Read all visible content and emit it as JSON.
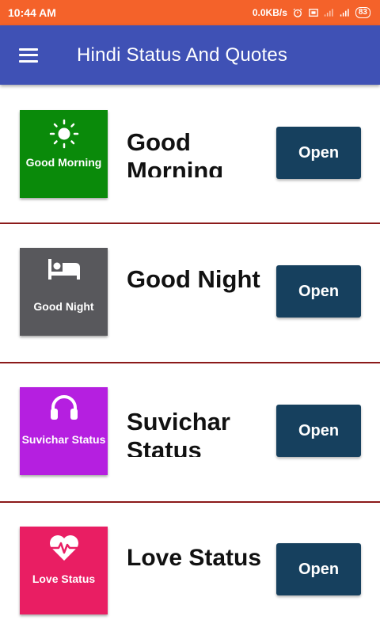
{
  "status_bar": {
    "time": "10:44 AM",
    "speed": "0.0KB/s",
    "battery": "83",
    "icons": [
      "alarm-icon",
      "data-saver-icon",
      "signal-4g-icon",
      "signal-icon",
      "battery-icon"
    ]
  },
  "app_bar": {
    "title": "Hindi Status And Quotes",
    "menu_icon": "hamburger-menu-icon"
  },
  "cards": [
    {
      "title": "Good Morning",
      "caption": "Good Morning",
      "icon": "sun-icon",
      "color": "#0a8a0a",
      "button": "Open"
    },
    {
      "title": "Good Night",
      "caption": "Good Night",
      "icon": "bed-icon",
      "color": "#58585c",
      "button": "Open"
    },
    {
      "title": "Suvichar Status",
      "caption": "Suvichar Status",
      "icon": "headphones-icon",
      "color": "#b51fe0",
      "button": "Open"
    },
    {
      "title": "Love Status",
      "caption": "Love Status",
      "icon": "heart-pulse-icon",
      "color": "#e91e63",
      "button": "Open"
    }
  ],
  "colors": {
    "status_bar": "#f4622a",
    "app_bar": "#3f51b5",
    "button": "#16405e",
    "divider": "#8b1a1a"
  }
}
